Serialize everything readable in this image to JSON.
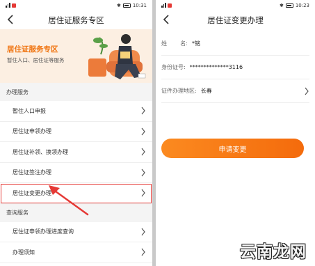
{
  "left": {
    "status_time": "10:31",
    "title": "居住证服务专区",
    "banner": {
      "title": "居住证服务专区",
      "subtitle": "暂住人口、居住证等服务"
    },
    "section1": "办理服务",
    "items1": [
      "暂住人口申报",
      "居住证申领办理",
      "居住证补领、换领办理",
      "居住证签注办理",
      "居住证变更办理"
    ],
    "section2": "查询服务",
    "items2": [
      "居住证申领办理进度查询",
      "办理须知"
    ]
  },
  "right": {
    "status_time": "10:23",
    "title": "居住证变更办理",
    "fields": {
      "name": {
        "label_a": "姓",
        "label_b": "名:",
        "value": "*铭"
      },
      "id_number": {
        "label": "身份证号:",
        "value": "**************3116"
      },
      "region": {
        "label": "证件办理地区:",
        "value": "长春"
      }
    },
    "apply_label": "申请变更"
  },
  "watermark": "云南龙网",
  "colors": {
    "accent": "#f07410",
    "highlight": "#e53935"
  }
}
